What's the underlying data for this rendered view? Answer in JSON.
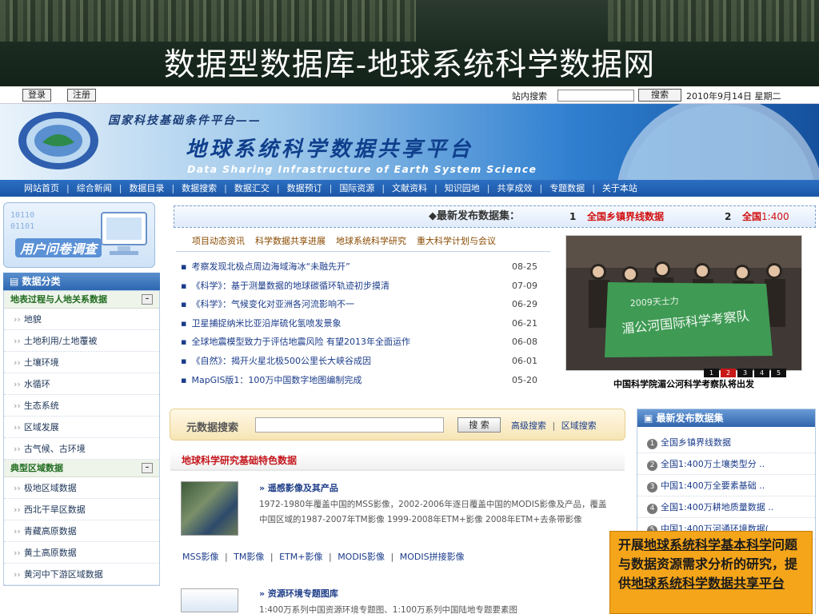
{
  "slide": {
    "title": "数据型数据库-地球系统科学数据网"
  },
  "topbar": {
    "login": "登录",
    "register": "注册",
    "search_label": "站内搜索",
    "search_button": "搜索",
    "date": "2010年9月14日  星期二"
  },
  "banner": {
    "org": "国家科技基础条件平台——",
    "title_cn": "地球系统科学数据共享平台",
    "title_en": "Data Sharing Infrastructure of Earth System Science"
  },
  "nav": [
    "网站首页",
    "综合新闻",
    "数据目录",
    "数据搜索",
    "数据汇交",
    "数据预订",
    "国际资源",
    "文献资料",
    "知识园地",
    "共享成效",
    "专题数据",
    "关于本站"
  ],
  "survey": {
    "label": "用户问卷调查"
  },
  "categories": {
    "header": "数据分类",
    "groups": [
      {
        "title": "地表过程与人地关系数据",
        "toggle": "–",
        "items": [
          "地貌",
          "土地利用/土地覆被",
          "土壤环境",
          "水循环",
          "生态系统",
          "区域发展",
          "古气候、古环境"
        ]
      },
      {
        "title": "典型区域数据",
        "toggle": "–",
        "items": [
          "极地区域数据",
          "西北干旱区数据",
          "青藏高原数据",
          "黄土高原数据",
          "黄河中下游区域数据"
        ]
      }
    ]
  },
  "latest_strip": {
    "label": "◆最新发布数据集：",
    "item1_num": "1",
    "item1": "全国乡镇界线数据",
    "item2_num": "2",
    "item2": "全国",
    "item2_suffix": "1:400"
  },
  "tabs": [
    "项目动态资讯",
    "科学数据共享进展",
    "地球系统科学研究",
    "重大科学计划与会议"
  ],
  "news": [
    {
      "title": "考察发现北极点周边海域海冰“未融先开”",
      "date": "08-25"
    },
    {
      "title": "《科学》：基于测量数据的地球碳循环轨迹初步摸清",
      "date": "07-09"
    },
    {
      "title": "《科学》：气候变化对亚洲各河流影响不一",
      "date": "06-29"
    },
    {
      "title": "卫星捕捉纳米比亚沿岸硫化氢喷发景象",
      "date": "06-21"
    },
    {
      "title": "全球地震模型致力于评估地震风险 有望2013年全面运作",
      "date": "06-08"
    },
    {
      "title": "《自然》：揭开火星北极500公里长大峡谷成因",
      "date": "06-01"
    },
    {
      "title": "MapGIS版1：100万中国数字地图编制完成",
      "date": "05-20"
    }
  ],
  "photo": {
    "caption": "中国科学院湄公河科学考察队将出发",
    "banner_text": "湄公河国际科学考察队",
    "banner_year": "2009天士力",
    "pages": [
      "1",
      "2",
      "3",
      "4",
      "5"
    ],
    "active_page": 1
  },
  "meta_search": {
    "label": "元数据搜索",
    "button": "搜 索",
    "advanced": "高级搜索",
    "region": "区域搜索"
  },
  "featured": {
    "title": "地球科学研究基础特色数据",
    "items": [
      {
        "title": "» 遥感影像及其产品",
        "desc": "1972-1980年覆盖中国的MSS影像，2002-2006年逐日覆盖中国的MODIS影像及产品，覆盖中国区域的1987-2007年TM影像 1999-2008年ETM+影像 2008年ETM+去条带影像",
        "links": [
          "MSS影像",
          "TM影像",
          "ETM+影像",
          "MODIS影像",
          "MODIS拼接影像"
        ]
      },
      {
        "title": "» 资源环境专题图库",
        "desc": "1:400万系列中国资源环境专题图、1:100万系列中国陆地专题要素图"
      }
    ]
  },
  "latest_box": {
    "title": "最新发布数据集",
    "items": [
      "全国乡镇界线数据",
      "全国1:400万土壤类型分 ..",
      "中国1:400万全要素基础 ..",
      "全国1:400万耕地质量数据 ..",
      "中国1:400万河通环境数据("
    ]
  },
  "note": {
    "text_pre": "开展",
    "text_link": "地球系统科学基本科学",
    "text_mid": "问题与数据资源需求分析的研究，提供",
    "text_link2": "地球系统科学数据共享平台"
  },
  "colors": {
    "nav": "#1c56a6",
    "accent_red": "#c3161c",
    "note_bg": "#f5a51a"
  }
}
